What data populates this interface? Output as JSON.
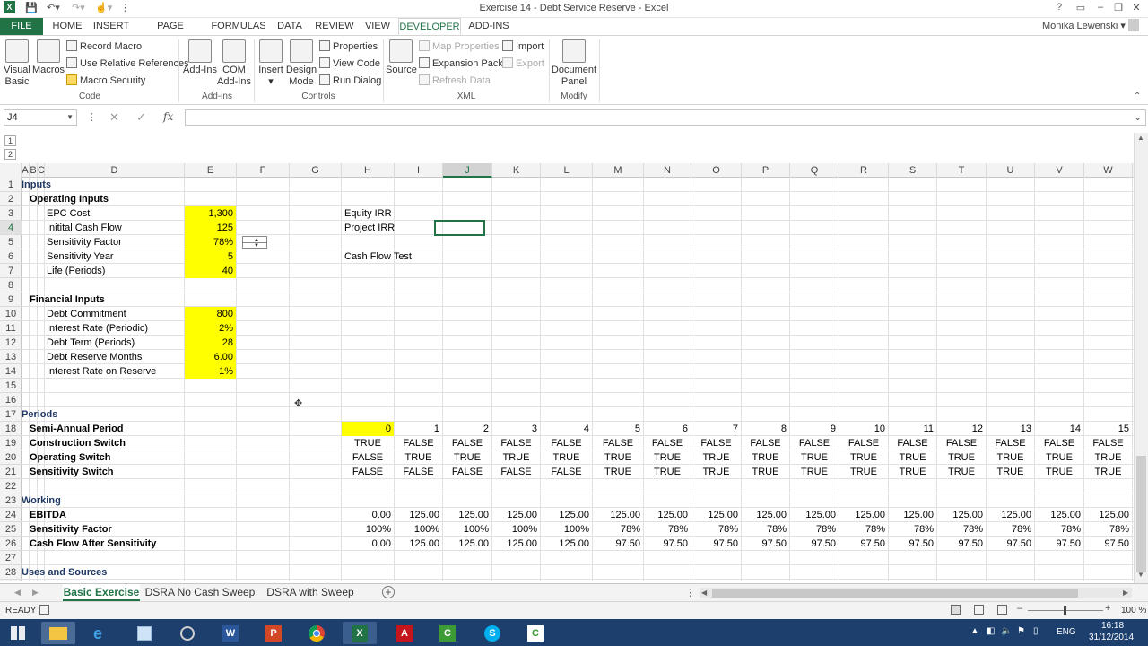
{
  "window": {
    "title": "Exercise 14 - Debt Service Reserve - Excel",
    "user": "Monika Lewenski"
  },
  "tabs": [
    "FILE",
    "HOME",
    "INSERT",
    "PAGE LAYOUT",
    "FORMULAS",
    "DATA",
    "REVIEW",
    "VIEW",
    "DEVELOPER",
    "ADD-INS"
  ],
  "ribbon": {
    "code": {
      "label": "Code",
      "visual_basic": "Visual Basic",
      "macros": "Macros",
      "record_macro": "Record Macro",
      "relative_refs": "Use Relative References",
      "macro_security": "Macro Security"
    },
    "addins": {
      "label": "Add-ins",
      "add_ins": "Add-Ins",
      "com_add_ins": "COM Add-Ins"
    },
    "controls": {
      "label": "Controls",
      "insert": "Insert",
      "design_mode": "Design Mode",
      "properties": "Properties",
      "view_code": "View Code",
      "run_dialog": "Run Dialog"
    },
    "xml": {
      "label": "XML",
      "source": "Source",
      "map_properties": "Map Properties",
      "expansion_packs": "Expansion Packs",
      "refresh_data": "Refresh Data",
      "import": "Import",
      "export": "Export"
    },
    "modify": {
      "label": "Modify",
      "document_panel": "Document Panel"
    }
  },
  "formula_bar": {
    "name_box": "J4",
    "fx": "fx",
    "formula": ""
  },
  "columns": [
    "A",
    "B",
    "C",
    "D",
    "E",
    "F",
    "G",
    "H",
    "I",
    "J",
    "K",
    "L",
    "M",
    "N",
    "O",
    "P",
    "Q",
    "R",
    "S",
    "T",
    "U",
    "V",
    "W"
  ],
  "rows": [
    "1",
    "2",
    "3",
    "4",
    "5",
    "6",
    "7",
    "8",
    "9",
    "10",
    "11",
    "12",
    "13",
    "14",
    "15",
    "16",
    "17",
    "18",
    "19",
    "20",
    "21",
    "22",
    "23",
    "24",
    "25",
    "26",
    "27",
    "28"
  ],
  "cells": {
    "r1": "Inputs",
    "r2": "Operating Inputs",
    "r3": {
      "label": "EPC Cost",
      "value": "1,300"
    },
    "r4": {
      "label": "Initital Cash Flow",
      "value": "125"
    },
    "r5": {
      "label": "Sensitivity Factor",
      "value": "78%"
    },
    "r6": {
      "label": "Sensitivity Year",
      "value": "5"
    },
    "r7": {
      "label": "Life (Periods)",
      "value": "40"
    },
    "r9": "Financial Inputs",
    "r10": {
      "label": "Debt Commitment",
      "value": "800"
    },
    "r11": {
      "label": "Interest Rate (Periodic)",
      "value": "2%"
    },
    "r12": {
      "label": "Debt Term (Periods)",
      "value": "28"
    },
    "r13": {
      "label": "Debt Reserve Months",
      "value": "6.00"
    },
    "r14": {
      "label": "Interest Rate on Reserve",
      "value": "1%"
    },
    "equity_irr": "Equity IRR",
    "project_irr": "Project IRR",
    "cash_flow_test": "Cash Flow Test",
    "r17": "Periods",
    "r18": "Semi-Annual Period",
    "r19": "Construction Switch",
    "r20": "Operating Switch",
    "r21": "Sensitivity Switch",
    "r23": "Working",
    "r24": "EBITDA",
    "r25": "Sensitivity Factor",
    "r26": "Cash Flow After Sensitivity",
    "r28": "Uses and Sources"
  },
  "table": {
    "periods": [
      "0",
      "1",
      "2",
      "3",
      "4",
      "5",
      "6",
      "7",
      "8",
      "9",
      "10",
      "11",
      "12",
      "13",
      "14",
      "15"
    ],
    "construction": [
      "TRUE",
      "FALSE",
      "FALSE",
      "FALSE",
      "FALSE",
      "FALSE",
      "FALSE",
      "FALSE",
      "FALSE",
      "FALSE",
      "FALSE",
      "FALSE",
      "FALSE",
      "FALSE",
      "FALSE",
      "FALSE"
    ],
    "operating": [
      "FALSE",
      "TRUE",
      "TRUE",
      "TRUE",
      "TRUE",
      "TRUE",
      "TRUE",
      "TRUE",
      "TRUE",
      "TRUE",
      "TRUE",
      "TRUE",
      "TRUE",
      "TRUE",
      "TRUE",
      "TRUE"
    ],
    "sensitivity": [
      "FALSE",
      "FALSE",
      "FALSE",
      "FALSE",
      "FALSE",
      "TRUE",
      "TRUE",
      "TRUE",
      "TRUE",
      "TRUE",
      "TRUE",
      "TRUE",
      "TRUE",
      "TRUE",
      "TRUE",
      "TRUE"
    ],
    "ebitda": [
      "0.00",
      "125.00",
      "125.00",
      "125.00",
      "125.00",
      "125.00",
      "125.00",
      "125.00",
      "125.00",
      "125.00",
      "125.00",
      "125.00",
      "125.00",
      "125.00",
      "125.00",
      "125.00"
    ],
    "sens_factor": [
      "100%",
      "100%",
      "100%",
      "100%",
      "100%",
      "78%",
      "78%",
      "78%",
      "78%",
      "78%",
      "78%",
      "78%",
      "78%",
      "78%",
      "78%",
      "78%"
    ],
    "cash_flow": [
      "0.00",
      "125.00",
      "125.00",
      "125.00",
      "125.00",
      "97.50",
      "97.50",
      "97.50",
      "97.50",
      "97.50",
      "97.50",
      "97.50",
      "97.50",
      "97.50",
      "97.50",
      "97.50"
    ]
  },
  "sheets": [
    "Basic Exercise",
    "DSRA No Cash Sweep",
    "DSRA with  Sweep"
  ],
  "status": {
    "mode": "READY",
    "zoom": "100 %"
  },
  "taskbar": {
    "lang": "ENG",
    "time": "16:18",
    "date": "31/12/2014"
  },
  "colors": {
    "excel_green": "#217346",
    "input_yellow": "#ffff00",
    "taskbar": "#1c3f6e"
  }
}
